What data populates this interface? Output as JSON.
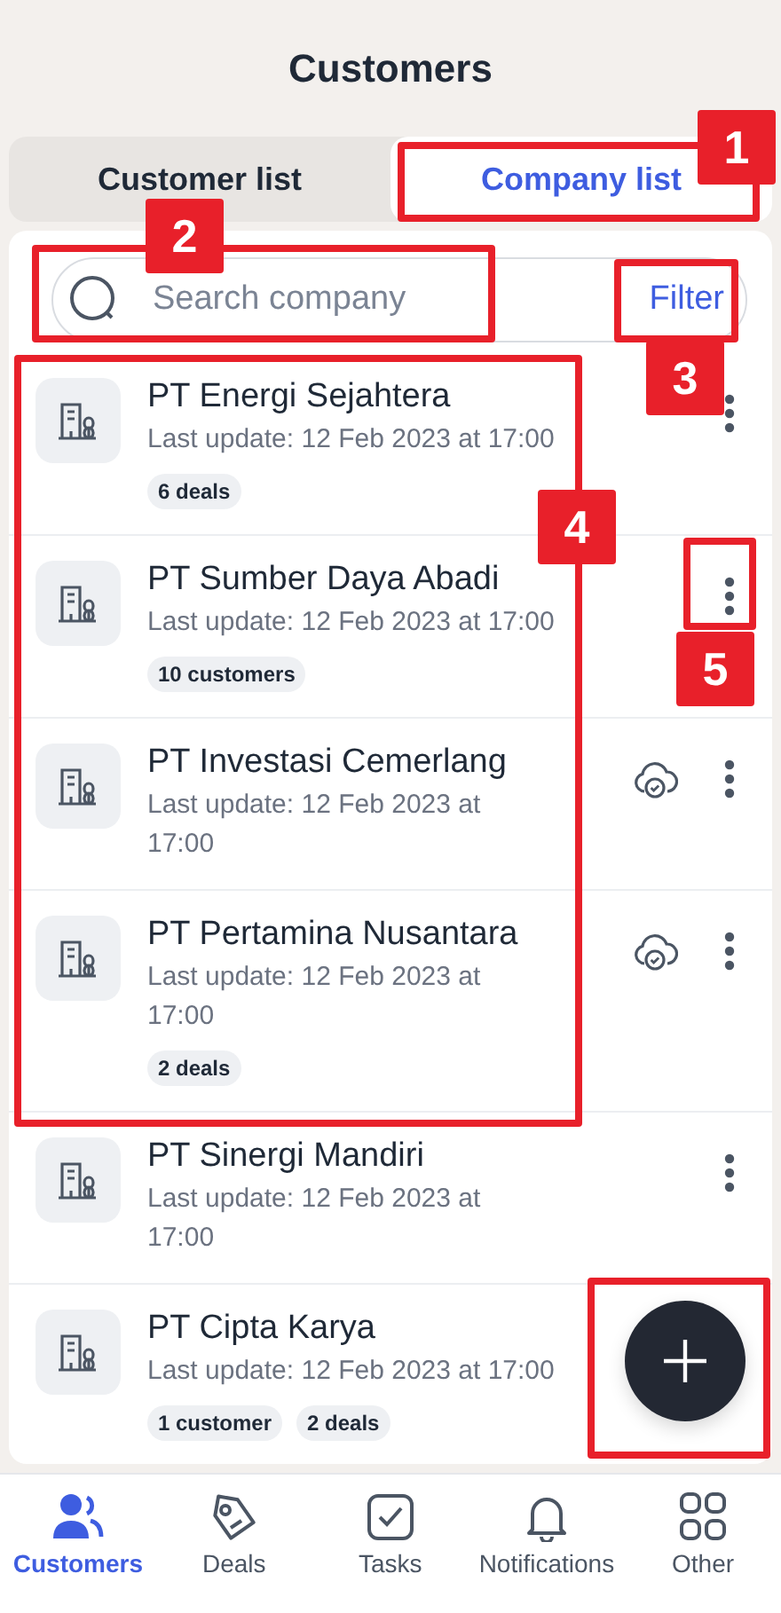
{
  "title": "Customers",
  "tabs": [
    {
      "label": "Customer list",
      "selected": false
    },
    {
      "label": "Company list",
      "selected": true
    }
  ],
  "search": {
    "placeholder": "Search company"
  },
  "filter": "Filter",
  "companies": [
    {
      "name": "PT Energi Sejahtera",
      "update": "Last update: 12 Feb 2023 at 17:00",
      "chips": [
        "6 deals"
      ],
      "synced": false,
      "menu": true
    },
    {
      "name": "PT Sumber Daya Abadi",
      "update": "Last update: 12 Feb 2023 at 17:00",
      "chips": [
        "10 customers"
      ],
      "synced": false,
      "menu": true
    },
    {
      "name": "PT Investasi Cemerlang",
      "update": "Last update: 12 Feb 2023 at 17:00",
      "synced": true,
      "menu": true
    },
    {
      "name": "PT Pertamina Nusantara",
      "update": "Last update: 12 Feb 2023 at 17:00",
      "chips": [
        "2 deals"
      ],
      "synced": true,
      "menu": true
    },
    {
      "name": "PT Sinergi Mandiri",
      "update": "Last update: 12 Feb 2023 at 17:00",
      "synced": false,
      "menu": true
    },
    {
      "name": "PT Cipta Karya",
      "update": "Last update: 12 Feb 2023 at 17:00",
      "chips": [
        "1 customer",
        "2 deals"
      ],
      "synced": false
    }
  ],
  "nav": [
    {
      "label": "Customers",
      "selected": true
    },
    {
      "label": "Deals",
      "selected": false
    },
    {
      "label": "Tasks",
      "selected": false
    },
    {
      "label": "Notifications",
      "selected": false
    },
    {
      "label": "Other",
      "selected": false
    }
  ],
  "annotations": [
    {
      "kind": "numbered",
      "label": "1"
    },
    {
      "kind": "numbered",
      "label": "2"
    },
    {
      "kind": "numbered",
      "label": "3"
    },
    {
      "kind": "numbered",
      "label": "4"
    },
    {
      "kind": "numbered",
      "label": "5"
    },
    {
      "kind": "box"
    }
  ]
}
